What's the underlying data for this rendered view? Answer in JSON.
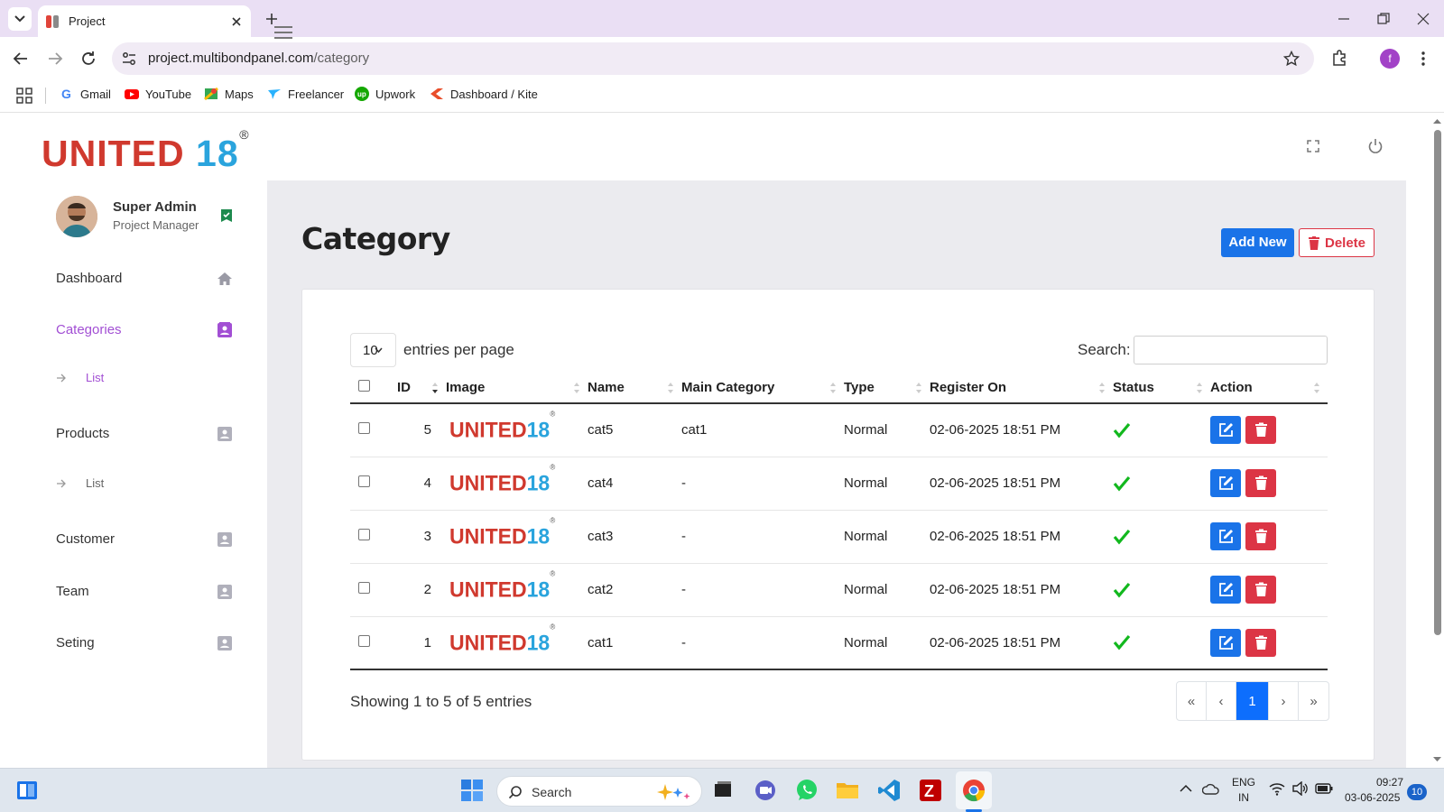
{
  "browser": {
    "tab_title": "Project",
    "url_domain": "project.multibondpanel.com",
    "url_path": "/category",
    "profile_initial": "f",
    "bookmarks": [
      {
        "label": "Gmail",
        "icon": "gmail-icon"
      },
      {
        "label": "YouTube",
        "icon": "youtube-icon"
      },
      {
        "label": "Maps",
        "icon": "maps-icon"
      },
      {
        "label": "Freelancer",
        "icon": "freelancer-icon"
      },
      {
        "label": "Upwork",
        "icon": "upwork-icon"
      },
      {
        "label": "Dashboard / Kite",
        "icon": "kite-icon"
      }
    ]
  },
  "brand": {
    "word": "UNITED",
    "number": "18",
    "reg": "®",
    "colors": {
      "red": "#d0392e",
      "blue": "#2aa4dd"
    }
  },
  "user": {
    "name": "Super Admin",
    "role": "Project Manager"
  },
  "sidebar": {
    "items": [
      {
        "label": "Dashboard",
        "icon": "home-icon"
      },
      {
        "label": "Categories",
        "icon": "contact-card-icon"
      },
      {
        "label": "List"
      },
      {
        "label": "Products",
        "icon": "contact-card-icon"
      },
      {
        "label": "List"
      },
      {
        "label": "Customer",
        "icon": "contact-card-icon"
      },
      {
        "label": "Team",
        "icon": "contact-card-icon"
      },
      {
        "label": "Seting",
        "icon": "contact-card-icon"
      }
    ],
    "accent": "#a24fd4"
  },
  "page": {
    "title": "Category",
    "add_new": "Add New",
    "delete": "Delete"
  },
  "table_controls": {
    "per_page_value": "10",
    "per_page_label": "entries per page",
    "search_label": "Search:",
    "search_value": ""
  },
  "table": {
    "headers": [
      "ID",
      "Image",
      "Name",
      "Main Category",
      "Type",
      "Register On",
      "Status",
      "Action"
    ],
    "rows": [
      {
        "id": "5",
        "name": "cat5",
        "main_category": "cat1",
        "type": "Normal",
        "register_on": "02-06-2025 18:51 PM"
      },
      {
        "id": "4",
        "name": "cat4",
        "main_category": "-",
        "type": "Normal",
        "register_on": "02-06-2025 18:51 PM"
      },
      {
        "id": "3",
        "name": "cat3",
        "main_category": "-",
        "type": "Normal",
        "register_on": "02-06-2025 18:51 PM"
      },
      {
        "id": "2",
        "name": "cat2",
        "main_category": "-",
        "type": "Normal",
        "register_on": "02-06-2025 18:51 PM"
      },
      {
        "id": "1",
        "name": "cat1",
        "main_category": "-",
        "type": "Normal",
        "register_on": "02-06-2025 18:51 PM"
      }
    ],
    "summary": "Showing 1 to 5 of 5 entries"
  },
  "pagination": {
    "first": "«",
    "prev": "‹",
    "current": "1",
    "next": "›",
    "last": "»"
  },
  "taskbar": {
    "search_placeholder": "Search",
    "lang": "ENG",
    "region": "IN",
    "time": "09:27",
    "date": "03-06-2025",
    "notifications": "10"
  }
}
